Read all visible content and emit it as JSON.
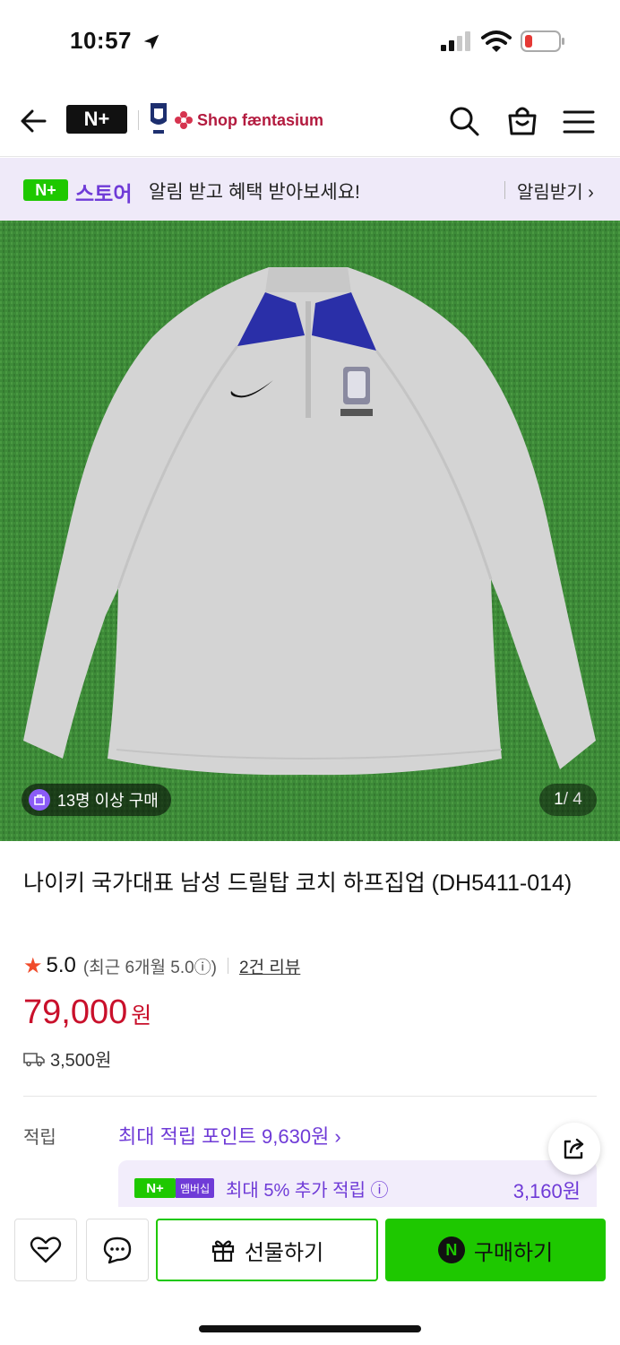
{
  "status_bar": {
    "time": "10:57"
  },
  "header": {
    "nplus_logo": "N+",
    "shop_name": "Shop fæntasium"
  },
  "store_banner": {
    "badge": "N+",
    "label": "스토어",
    "message": "알림 받고 혜택 받아보세요!",
    "cta": "알림받기 ›"
  },
  "product_image": {
    "purchase_chip": "13명 이상 구매",
    "page_current": "1",
    "page_total": "/ 4"
  },
  "product": {
    "title": "나이키 국가대표 남성 드릴탑 코치 하프집업 (DH5411-014)",
    "rating": "5.0",
    "rating_recent": "(최근 6개월 5.0ⓘ)",
    "review_link": "2건 리뷰",
    "price": "79,000",
    "price_unit": "원",
    "shipping": "3,500원"
  },
  "points": {
    "label": "적립",
    "max_points_link": "최대 적립 포인트 9,630원 ›",
    "member_badge_n": "N+",
    "member_badge_tag": "멤버십",
    "member_text": "최대 5% 추가 적립 ⓘ",
    "member_amount": "3,160원"
  },
  "bottom_bar": {
    "gift_label": "선물하기",
    "buy_icon": "N",
    "buy_label": "구매하기"
  },
  "colors": {
    "naver_green": "#1ec800",
    "purple": "#6f3bd7",
    "price_red": "#c9102b",
    "banner_bg": "#efeaf9"
  }
}
